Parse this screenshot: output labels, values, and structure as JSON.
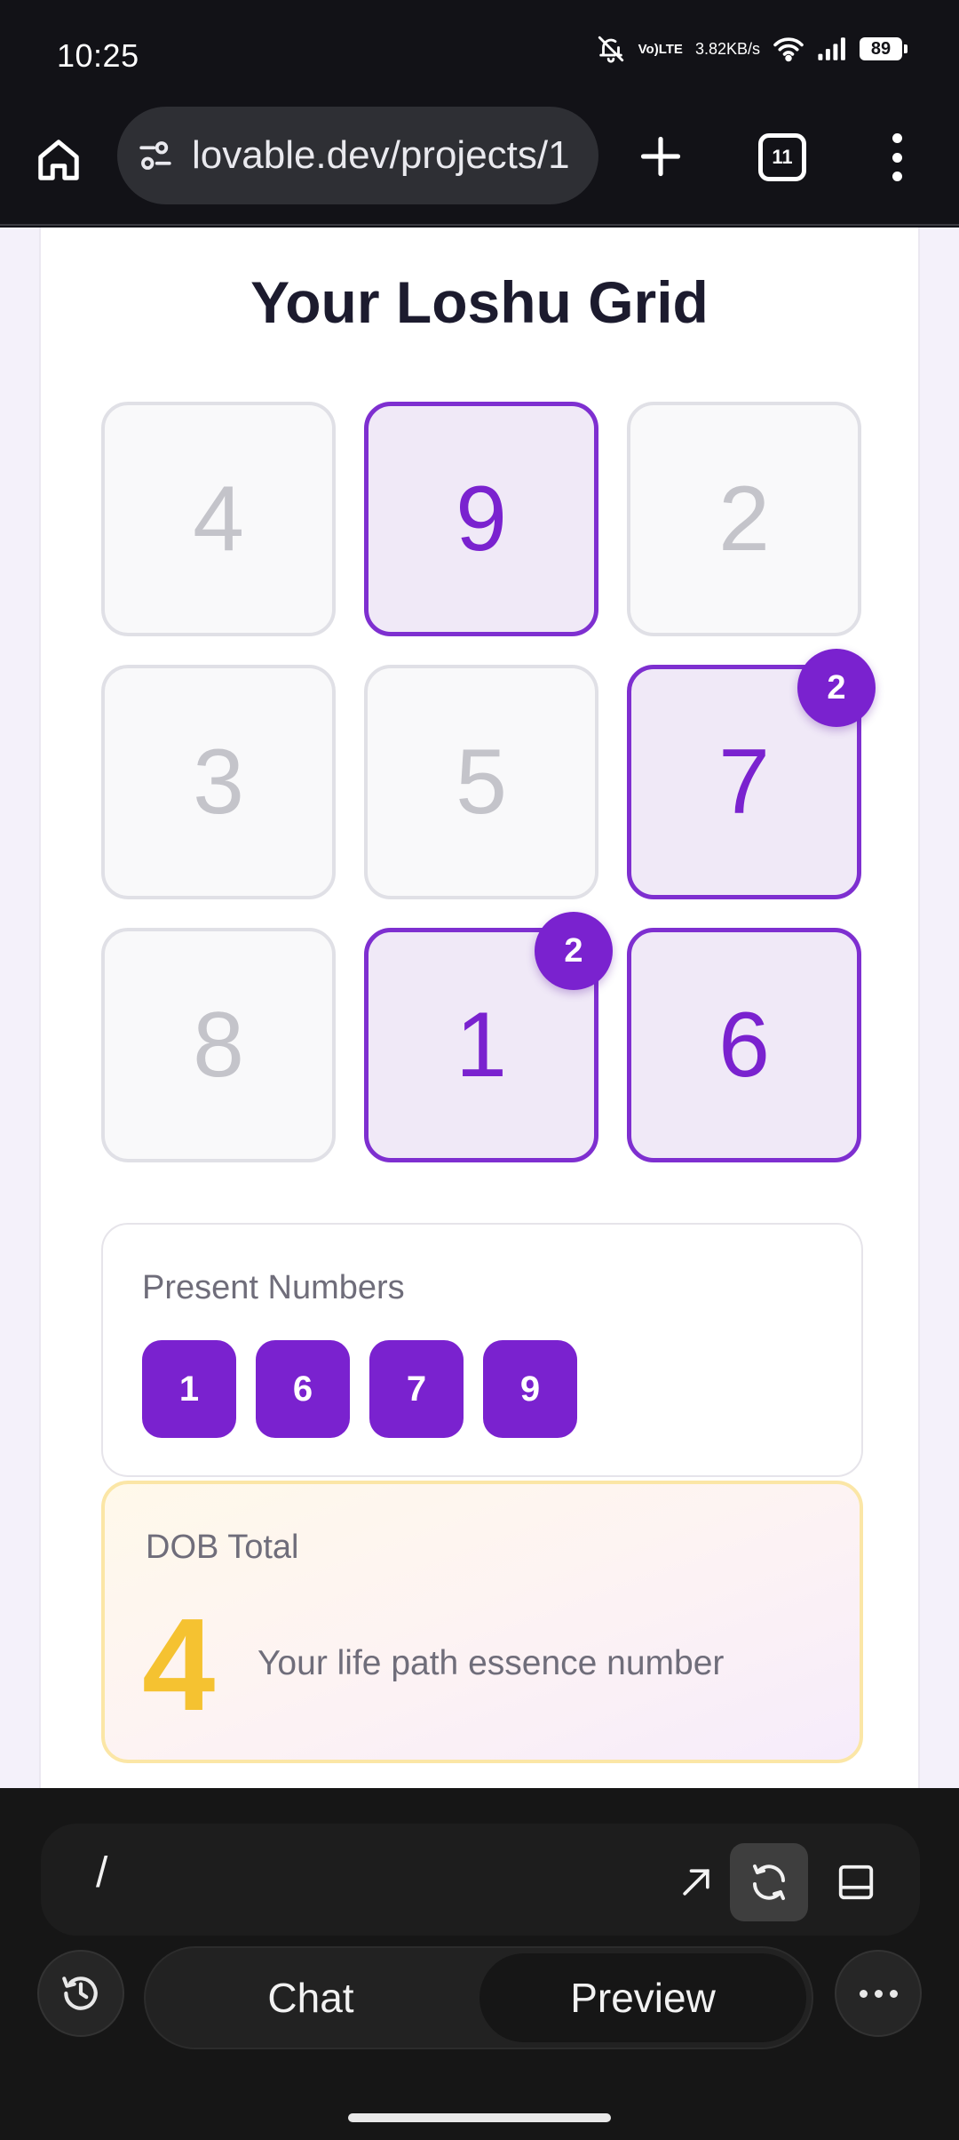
{
  "status_bar": {
    "time": "10:25",
    "volte": [
      "Vo)",
      "LTE"
    ],
    "net_speed_value": "3.82",
    "net_speed_unit": "KB/s",
    "battery": "89",
    "icons": [
      "bell-off-icon",
      "volte-icon",
      "wifi-icon",
      "signal-icon",
      "battery-icon"
    ]
  },
  "browser": {
    "url": "lovable.dev/projects/1",
    "tab_count": "11",
    "icons": [
      "home-icon",
      "site-info-icon",
      "plus-icon",
      "tabs-icon",
      "more-vert-icon"
    ]
  },
  "page": {
    "title": "Your Loshu Grid",
    "grid": [
      {
        "number": "4",
        "present": false
      },
      {
        "number": "9",
        "present": true
      },
      {
        "number": "2",
        "present": false
      },
      {
        "number": "3",
        "present": false
      },
      {
        "number": "5",
        "present": false
      },
      {
        "number": "7",
        "present": true,
        "count": "2"
      },
      {
        "number": "8",
        "present": false
      },
      {
        "number": "1",
        "present": true,
        "count": "2"
      },
      {
        "number": "6",
        "present": true
      }
    ],
    "present_numbers": {
      "label": "Present Numbers",
      "values": [
        "1",
        "6",
        "7",
        "9"
      ]
    },
    "dob_total": {
      "label": "DOB Total",
      "value": "4",
      "description": "Your life path essence number"
    },
    "colors": {
      "accent": "#7a22cf",
      "dob_value": "#f5c231"
    }
  },
  "app_bar": {
    "route": "/",
    "icons": [
      "open-external-icon",
      "refresh-icon",
      "layout-panel-icon",
      "history-icon",
      "more-horiz-icon"
    ],
    "tabs": [
      {
        "label": "Chat",
        "active": false
      },
      {
        "label": "Preview",
        "active": true
      }
    ]
  }
}
